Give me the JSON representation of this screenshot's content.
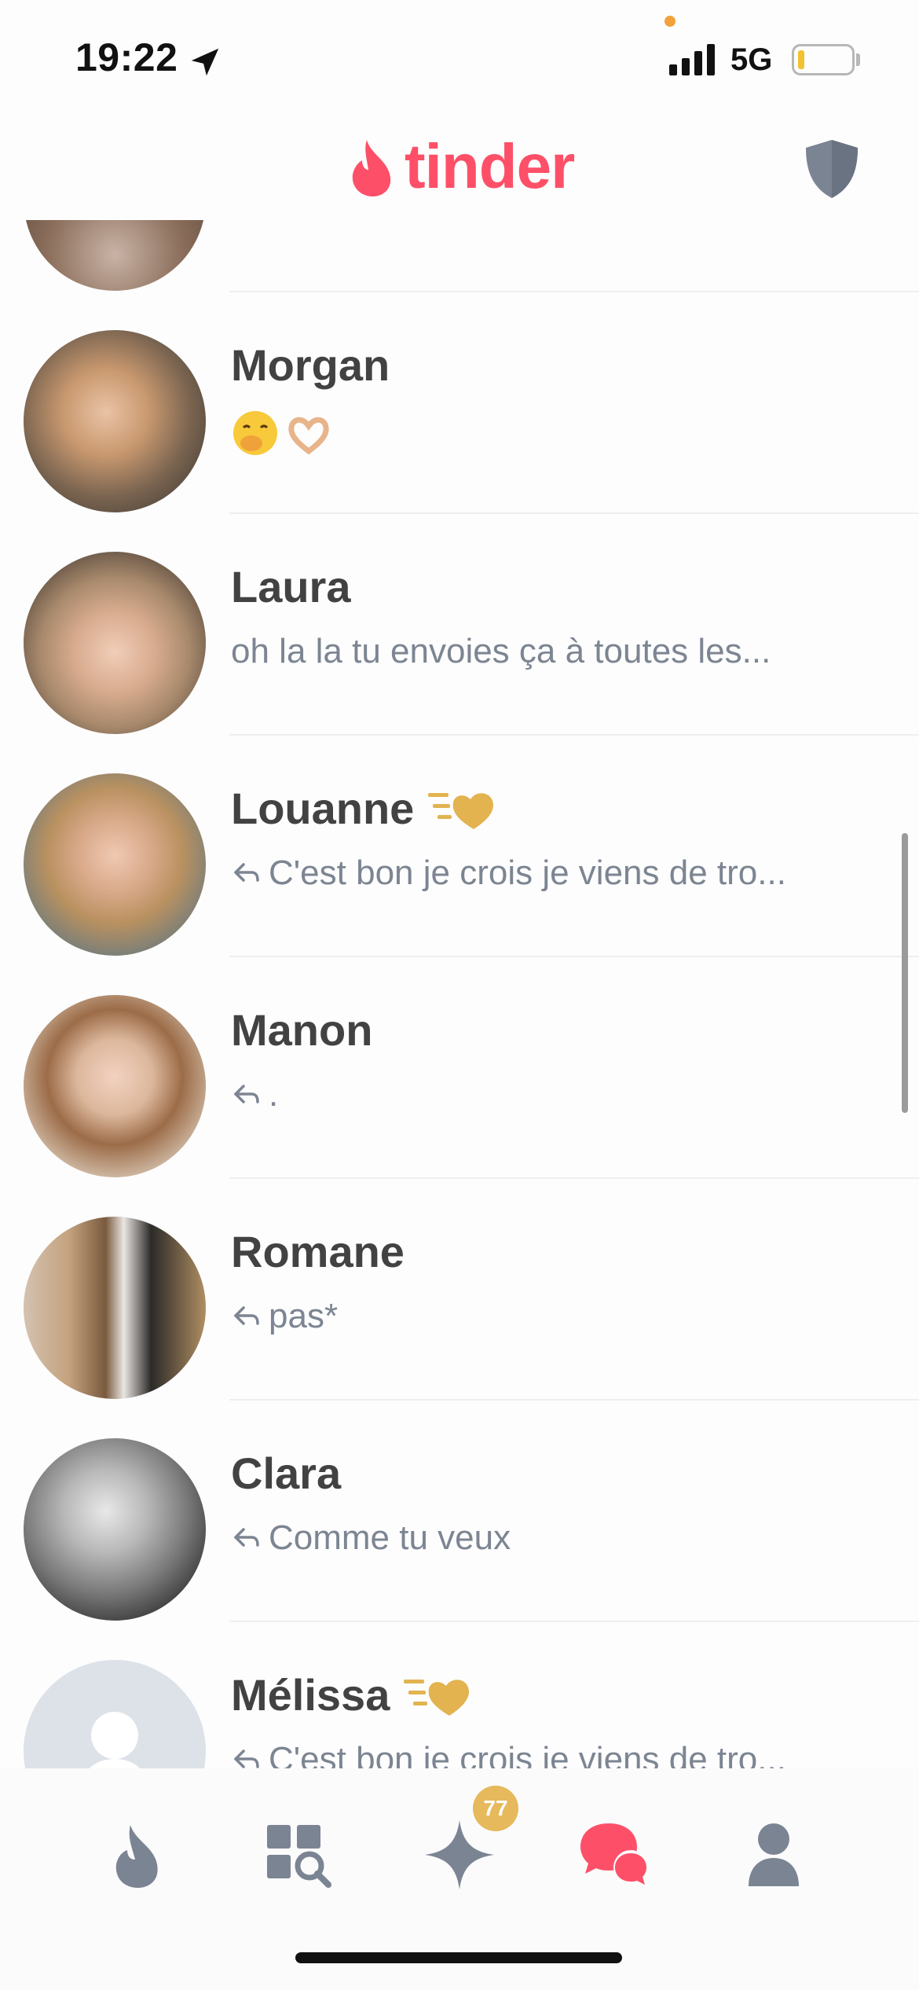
{
  "status_bar": {
    "time": "19:22",
    "network": "5G"
  },
  "header": {
    "logo_text": "tinder",
    "brand_color": "#fd5068"
  },
  "matches": [
    {
      "name": "",
      "message": "",
      "reply": false
    },
    {
      "name": "Morgan",
      "message": "",
      "emoji": [
        "🤭",
        "🫶"
      ],
      "reply": false
    },
    {
      "name": "Laura",
      "message": "oh la la tu envoies ça à toutes les...",
      "reply": false
    },
    {
      "name": "Louanne",
      "message": "C'est bon je crois je viens de tro...",
      "reply": true,
      "super_like": true
    },
    {
      "name": "Manon",
      "message": ".",
      "reply": true
    },
    {
      "name": "Romane",
      "message": "pas*",
      "reply": true
    },
    {
      "name": "Clara",
      "message": "Comme tu veux",
      "reply": true
    },
    {
      "name": "Mélissa",
      "message": "C'est bon je crois je viens de tro...",
      "reply": true,
      "super_like": true
    }
  ],
  "tabs": [
    {
      "name": "discover",
      "icon": "flame-icon"
    },
    {
      "name": "explore",
      "icon": "explore-grid-icon"
    },
    {
      "name": "likes",
      "icon": "sparkle-icon",
      "badge": "77"
    },
    {
      "name": "messages",
      "icon": "chat-bubbles-icon",
      "active": true
    },
    {
      "name": "profile",
      "icon": "person-icon"
    }
  ]
}
